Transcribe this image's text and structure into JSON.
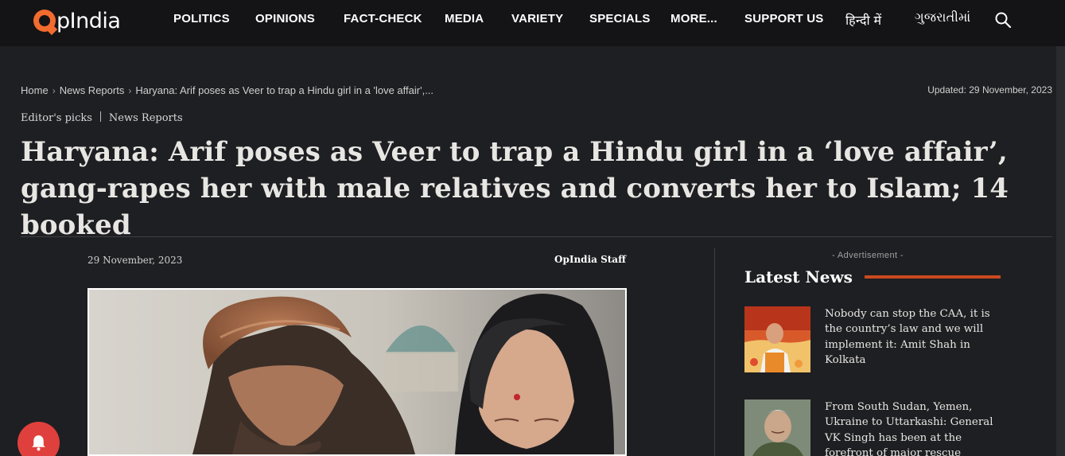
{
  "site": {
    "logo_text": "pIndia",
    "logo_mark": "O",
    "brand_color": "#f26b2f"
  },
  "nav": {
    "items": [
      "POLITICS",
      "OPINIONS",
      "FACT-CHECK",
      "MEDIA",
      "VARIETY",
      "SPECIALS",
      "MORE...",
      "SUPPORT US",
      "हिन्दी में",
      "ગુજરાતીમાં"
    ],
    "search_icon": "search-icon"
  },
  "breadcrumb": {
    "home": "Home",
    "section": "News Reports",
    "current": "Haryana: Arif poses as Veer to trap a Hindu girl in a 'love affair',..."
  },
  "updated": "Updated: 29 November, 2023",
  "categories": [
    "Editor's picks",
    "News Reports"
  ],
  "article": {
    "headline": "Haryana: Arif poses as Veer to trap a Hindu girl in a ‘love affair’, gang-rapes her with male relatives and converts her to Islam; 14 booked",
    "date": "29 November, 2023",
    "author": "OpIndia Staff"
  },
  "sidebar": {
    "ad_label": "- Advertisement -",
    "latest_title": "Latest News",
    "accent_color": "#c94a1f",
    "items": [
      {
        "title": "Nobody can stop the CAA, it is the country’s law and we will implement it: Amit Shah in Kolkata"
      },
      {
        "title": "From South Sudan, Yemen, Ukraine to Uttarkashi: General VK Singh has been at the forefront of major rescue"
      }
    ]
  },
  "notification": {
    "icon": "bell-icon",
    "color": "#e0403d"
  }
}
